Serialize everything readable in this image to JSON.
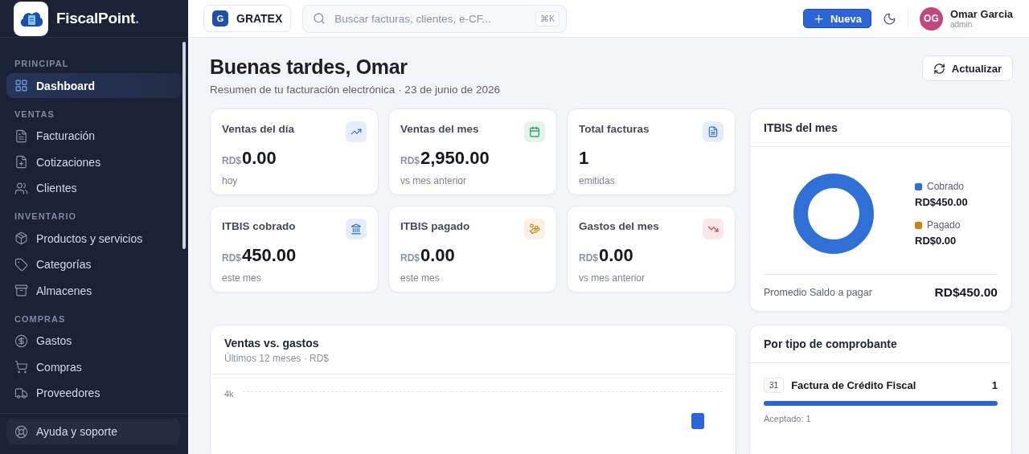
{
  "brand": {
    "name": "FiscalPoint",
    "dot": "."
  },
  "sidebar": {
    "sections": [
      {
        "title": "PRINCIPAL",
        "items": [
          {
            "label": "Dashboard",
            "selected": true
          }
        ]
      },
      {
        "title": "VENTAS",
        "items": [
          {
            "label": "Facturación",
            "selected": false
          },
          {
            "label": "Cotizaciones",
            "selected": false
          },
          {
            "label": "Clientes",
            "selected": false
          }
        ]
      },
      {
        "title": "INVENTARIO",
        "items": [
          {
            "label": "Productos y servicios",
            "selected": false
          },
          {
            "label": "Categorías",
            "selected": false
          },
          {
            "label": "Almacenes",
            "selected": false
          }
        ]
      },
      {
        "title": "COMPRAS",
        "items": [
          {
            "label": "Gastos",
            "selected": false
          },
          {
            "label": "Compras",
            "selected": false
          },
          {
            "label": "Proveedores",
            "selected": false
          }
        ]
      }
    ],
    "help": "Ayuda y soporte"
  },
  "header": {
    "company": {
      "initial": "G",
      "name": "GRATEX"
    },
    "search": {
      "placeholder": "Buscar facturas, clientes, e-CF...",
      "shortcut": "⌘K"
    },
    "new_button": "Nueva",
    "user": {
      "initials": "OG",
      "name": "Omar Garcia",
      "role": "admin"
    }
  },
  "greeting": {
    "title": "Buenas tardes, Omar",
    "subtitle": "Resumen de tu facturación electrónica · 23 de junio de 2026",
    "refresh_button": "Actualizar"
  },
  "stats": [
    {
      "title": "Ventas del día",
      "currency": "RD$",
      "value": "0.00",
      "note": "hoy",
      "color": "#2f6fd6"
    },
    {
      "title": "Ventas del mes",
      "currency": "RD$",
      "value": "2,950.00",
      "note": "vs mes anterior",
      "color": "#1f9a5a"
    },
    {
      "title": "Total facturas",
      "value": "1",
      "note": "emitidas",
      "color": "#2f6fd6"
    },
    {
      "title": "ITBIS cobrado",
      "currency": "RD$",
      "value": "450.00",
      "note": "este mes",
      "color": "#2f6fd6"
    },
    {
      "title": "ITBIS pagado",
      "currency": "RD$",
      "value": "0.00",
      "note": "este mes",
      "color": "#c98512"
    },
    {
      "title": "Gastos del mes",
      "currency": "RD$",
      "value": "0.00",
      "note": "vs mes anterior",
      "color": "#d63a4a"
    }
  ],
  "itbis": {
    "title": "ITBIS del mes",
    "legend": [
      {
        "label": "Cobrado",
        "value": "RD$450.00",
        "color": "#2f6fd6"
      },
      {
        "label": "Pagado",
        "value": "RD$0.00",
        "color": "#c98512"
      }
    ],
    "footer_label": "Promedio Saldo a pagar",
    "footer_value": "RD$450.00"
  },
  "sales_chart": {
    "title": "Ventas vs. gastos",
    "subtitle": "Últimos 12 meses · RD$",
    "tick_label": "4k"
  },
  "by_type": {
    "title": "Por tipo de comprobante",
    "items": [
      {
        "code": "31",
        "name": "Factura de Crédito Fiscal",
        "count": "1",
        "level": 1,
        "status": "Aceptado: 1"
      }
    ]
  }
}
